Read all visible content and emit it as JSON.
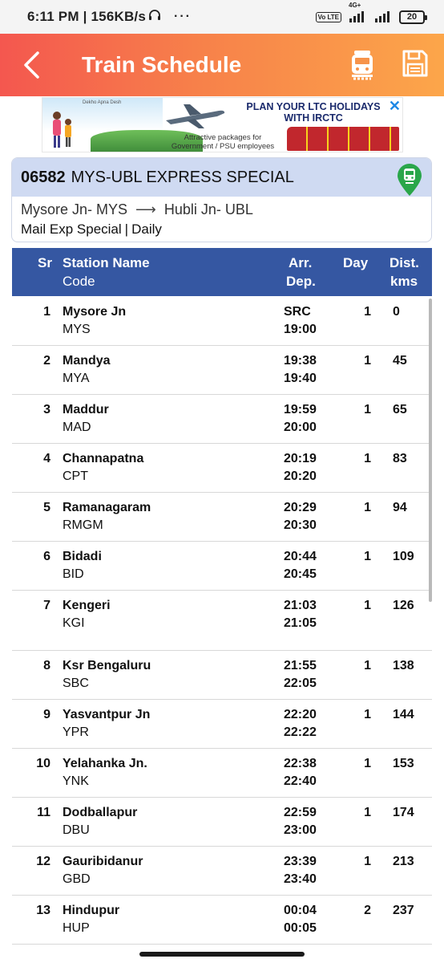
{
  "status_bar": {
    "time": "6:11 PM | 156KB/s",
    "dots": "···",
    "network_label": "4G+",
    "volte_label": "Vo LTE",
    "battery": "20"
  },
  "app_bar": {
    "title": "Train Schedule",
    "icons": [
      "back-arrow-icon",
      "train-icon",
      "save-icon"
    ]
  },
  "ad": {
    "headline": "PLAN YOUR LTC HOLIDAYS WITH IRCTC",
    "subtext": "Attractive packages for Government / PSU employees",
    "brand_small": "Dekho Apna Desh",
    "close_label": "✕"
  },
  "train": {
    "number": "06582",
    "name": "MYS-UBL EXPRESS SPECIAL",
    "from": "Mysore Jn- MYS",
    "arrow": "⟶",
    "to": "Hubli Jn- UBL",
    "type": "Mail Exp Special",
    "separator": "|",
    "runs": "Daily"
  },
  "table": {
    "headers": {
      "sr": "Sr",
      "station_name": "Station Name",
      "code": "Code",
      "arr": "Arr.",
      "dep": "Dep.",
      "day": "Day",
      "dist1": "Dist.",
      "dist2": "kms"
    },
    "rows": [
      {
        "sr": "1",
        "name": "Mysore Jn",
        "code": "MYS",
        "arr": "SRC",
        "dep": "19:00",
        "day": "1",
        "dist": "0"
      },
      {
        "sr": "2",
        "name": "Mandya",
        "code": "MYA",
        "arr": "19:38",
        "dep": "19:40",
        "day": "1",
        "dist": "45"
      },
      {
        "sr": "3",
        "name": "Maddur",
        "code": "MAD",
        "arr": "19:59",
        "dep": "20:00",
        "day": "1",
        "dist": "65"
      },
      {
        "sr": "4",
        "name": "Channapatna",
        "code": "CPT",
        "arr": "20:19",
        "dep": "20:20",
        "day": "1",
        "dist": "83"
      },
      {
        "sr": "5",
        "name": "Ramanagaram",
        "code": "RMGM",
        "arr": "20:29",
        "dep": "20:30",
        "day": "1",
        "dist": "94"
      },
      {
        "sr": "6",
        "name": "Bidadi",
        "code": "BID",
        "arr": "20:44",
        "dep": "20:45",
        "day": "1",
        "dist": "109"
      },
      {
        "sr": "7",
        "name": "Kengeri",
        "code": "KGI",
        "arr": "21:03",
        "dep": "21:05",
        "day": "1",
        "dist": "126"
      },
      {
        "sr": "8",
        "name": "Ksr Bengaluru",
        "code": "SBC",
        "arr": "21:55",
        "dep": "22:05",
        "day": "1",
        "dist": "138"
      },
      {
        "sr": "9",
        "name": "Yasvantpur Jn",
        "code": "YPR",
        "arr": "22:20",
        "dep": "22:22",
        "day": "1",
        "dist": "144"
      },
      {
        "sr": "10",
        "name": "Yelahanka Jn.",
        "code": "YNK",
        "arr": "22:38",
        "dep": "22:40",
        "day": "1",
        "dist": "153"
      },
      {
        "sr": "11",
        "name": "Dodballapur",
        "code": "DBU",
        "arr": "22:59",
        "dep": "23:00",
        "day": "1",
        "dist": "174"
      },
      {
        "sr": "12",
        "name": "Gauribidanur",
        "code": "GBD",
        "arr": "23:39",
        "dep": "23:40",
        "day": "1",
        "dist": "213"
      },
      {
        "sr": "13",
        "name": "Hindupur",
        "code": "HUP",
        "arr": "00:04",
        "dep": "00:05",
        "day": "2",
        "dist": "237"
      }
    ]
  },
  "colors": {
    "app_bar_start": "#f4574f",
    "app_bar_end": "#fca64a",
    "table_header": "#3557a2",
    "card_header": "#cfdaf2",
    "pin_green": "#2aa64a"
  }
}
